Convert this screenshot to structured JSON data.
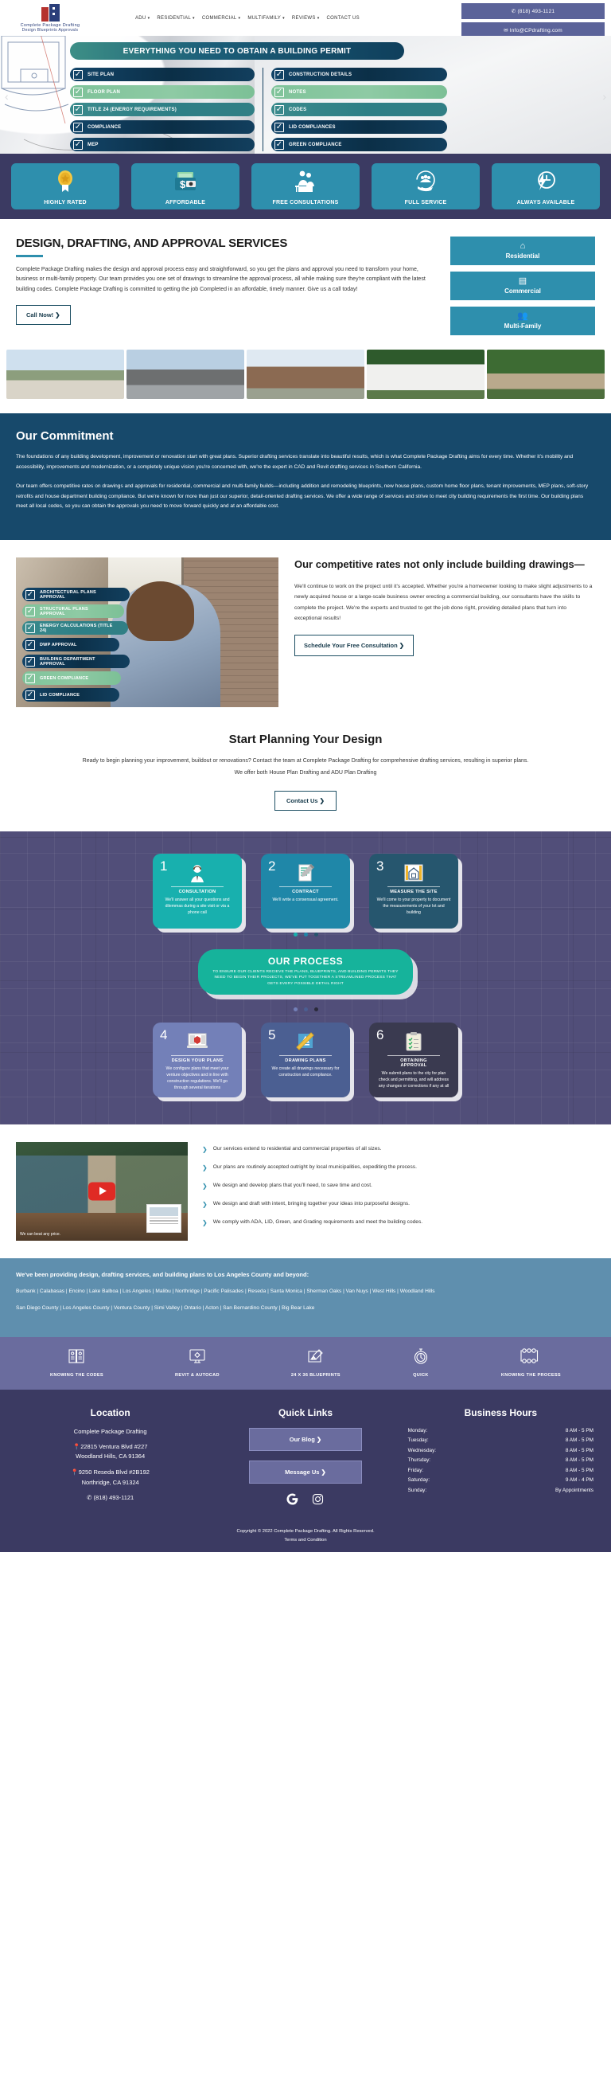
{
  "header": {
    "logo": {
      "line1": "Complete Package Drafting",
      "line2": "Design Blueprints Approvals"
    },
    "nav": [
      {
        "label": "ADU",
        "caret": "▾"
      },
      {
        "label": "RESIDENTIAL",
        "caret": "▾"
      },
      {
        "label": "COMMERCIAL",
        "caret": "▾"
      },
      {
        "label": "MULTIFAMILY",
        "caret": "▾"
      },
      {
        "label": "REVIEWS",
        "caret": "▾"
      },
      {
        "label": "CONTACT US",
        "caret": ""
      }
    ],
    "phone_button": "(818) 493-1121",
    "email_button": "Info@CPdrafting.com",
    "phone_icon": "phone-icon",
    "email_icon": "envelope-icon"
  },
  "hero": {
    "title": "EVERYTHING YOU NEED TO OBTAIN A BUILDING PERMIT",
    "prev_arrow": "‹",
    "next_arrow": "›",
    "left_items": [
      {
        "label": "SITE PLAN",
        "style": "dark"
      },
      {
        "label": "FLOOR PLAN",
        "style": "green"
      },
      {
        "label": "TITLE 24 (ENERGY REQUIREMENTS)",
        "style": "teal"
      },
      {
        "label": "COMPLIANCE",
        "style": "dark"
      },
      {
        "label": "MEP",
        "style": "dark"
      }
    ],
    "right_items": [
      {
        "label": "CONSTRUCTION DETAILS",
        "style": "dark"
      },
      {
        "label": "NOTES",
        "style": "green"
      },
      {
        "label": "CODES",
        "style": "teal"
      },
      {
        "label": "LID COMPLIANCES",
        "style": "dark"
      },
      {
        "label": "GREEN COMPLIANCE",
        "style": "dark"
      }
    ]
  },
  "features": [
    {
      "label": "HIGHLY RATED",
      "icon": "medal-icon",
      "glyph": "🏅"
    },
    {
      "label": "AFFORDABLE",
      "icon": "wallet-money-icon",
      "glyph": "💵"
    },
    {
      "label": "FREE CONSULTATIONS",
      "icon": "consultation-desk-icon",
      "glyph": "🧑‍💼"
    },
    {
      "label": "FULL SERVICE",
      "icon": "hand-people-icon",
      "glyph": "🤝"
    },
    {
      "label": "ALWAYS AVAILABLE",
      "icon": "clock-bolt-icon",
      "glyph": "⏱"
    }
  ],
  "services": {
    "heading": "DESIGN, DRAFTING, AND APPROVAL SERVICES",
    "paragraph": "Complete Package Drafting makes the design and approval process easy and straightforward, so you get the plans and approval you need to transform your home, business or multi-family property. Our team provides you one set of drawings to streamline the approval process, all while making sure they're compliant with the latest building codes. Complete Package Drafting is committed to getting the job Completed in an affordable, timely manner. Give us a call today!",
    "cta": "Call Now! ❯",
    "cards": [
      {
        "label": "Residential",
        "icon": "house-icon",
        "glyph": "⌂"
      },
      {
        "label": "Commercial",
        "icon": "office-building-icon",
        "glyph": "🏢"
      },
      {
        "label": "Multi-Family",
        "icon": "people-group-icon",
        "glyph": "👥"
      }
    ]
  },
  "gallery": [
    {
      "name": "project-photo-1"
    },
    {
      "name": "project-photo-2"
    },
    {
      "name": "project-photo-3"
    },
    {
      "name": "project-photo-4"
    },
    {
      "name": "project-photo-5"
    }
  ],
  "commitment": {
    "heading": "Our Commitment",
    "p1": "The foundations of any building development, improvement or renovation start with great plans. Superior drafting services translate into beautiful results, which is what Complete Package Drafting aims for every time. Whether it's mobility and accessibility, improvements and modernization, or a completely unique vision you're concerned with, we're the expert in CAD and Revit drafting services in Southern California.",
    "p2": "Our team offers competitive rates on drawings and approvals for residential, commercial and multi-family builds—including addition and remodeling blueprints, new house plans, custom home floor plans, tenant improvements, MEP plans, soft-story retrofits and house department building compliance. But we're known for more than just our superior, detail-oriented drafting services. We offer a wide range of services and strive to meet city building requirements the first time. Our building plans meet all local codes, so you can obtain the approvals you need to move forward quickly and at an affordable cost."
  },
  "rates": {
    "heading": "Our competitive rates not only include building drawings—",
    "paragraph": "We'll continue to work on the project until it's accepted. Whether you're a homeowner looking to make slight adjustments to a newly acquired house or a large-scale business owner erecting a commercial building, our consultants have the skills to complete the project. We're the experts and trusted to get the job done right, providing detailed plans that turn into exceptional results!",
    "cta": "Schedule Your Free Consultation ❯",
    "items": [
      {
        "label": "ARCHITECTURAL PLANS APPROVAL",
        "style": "dark",
        "width": 135
      },
      {
        "label": "STRUCTURAL PLANS APPROVAL",
        "style": "green",
        "width": 128
      },
      {
        "label": "ENERGY CALCULATIONS (TITLE 24)",
        "style": "teal",
        "width": 133
      },
      {
        "label": "DWP APPROVAL",
        "style": "dark",
        "width": 122
      },
      {
        "label": "BUILDING DEPARTMENT APPROVAL",
        "style": "dark",
        "width": 135
      },
      {
        "label": "GREEN COMPLIANCE",
        "style": "green",
        "width": 124
      },
      {
        "label": "LID COMPLIANCE",
        "style": "dark",
        "width": 122
      }
    ]
  },
  "planning": {
    "heading": "Start Planning Your Design",
    "p1": "Ready to begin planning your improvement, buildout or renovations? Contact the team at Complete Package Drafting for comprehensive drafting services, resulting in superior plans.",
    "p2": "We offer both House Plan Drafting and ADU Plan Drafting",
    "cta": "Contact Us ❯"
  },
  "process": {
    "pill_title": "OUR PROCESS",
    "pill_text": "TO ENSURE OUR CLIENTS RECIEVE THE PLANS, BLUEPRINTS, AND BUILDING PERMITS THEY NEED TO BEGIN THEIR PROJECTS, WE'VE PUT TOGETHER A STREAMLINED PROCESS THAT GETS EVERY POSSIBLE DETAIL RIGHT",
    "top_steps": [
      {
        "num": "1",
        "title": "CONSULTATION",
        "desc": "We'll answer all your questions and dilemmas during a site visit or via a phone call",
        "icon": "headset-agent-icon",
        "glyph": "🧑‍💼"
      },
      {
        "num": "2",
        "title": "CONTRACT",
        "desc": "We'll write a consensual agreement.",
        "icon": "document-pen-icon",
        "glyph": "📝"
      },
      {
        "num": "3",
        "title": "MEASURE THE SITE",
        "desc": "We'll come to your property to document the measurements of your lot and building",
        "icon": "measure-ruler-icon",
        "glyph": "📐"
      }
    ],
    "bottom_steps": [
      {
        "num": "4",
        "title": "DESIGN YOUR PLANS",
        "desc": "We configure plans that meet your venture objectives and in line with construction regulations. We'll go through several iterations",
        "icon": "laptop-3d-icon",
        "glyph": "💻"
      },
      {
        "num": "5",
        "title": "DRAWING PLANS",
        "desc": "We create all drawings necessary for construction and compliance.",
        "icon": "drafting-tools-icon",
        "glyph": "📏"
      },
      {
        "num": "6",
        "title": "OBTAINING APPROVAL",
        "desc": "We submit plans to the city for plan check and permitting, and will address any changes or corrections if any at all",
        "icon": "clipboard-check-icon",
        "glyph": "📋"
      }
    ]
  },
  "video_section": {
    "play_icon": "play-button-icon",
    "caption": "We can beat any price.",
    "bullets": [
      "Our services extend to residential and commercial properties of all sizes.",
      "Our plans are routinely accepted outright by local municipalities, expediting the process.",
      "We design and develop plans that you'll need, to save time and cost.",
      "We design and draft with intent, bringing together your ideas into purposeful designs.",
      "We comply with ADA, LID, Green, and Grading requirements and meet the building codes."
    ]
  },
  "areas": {
    "heading": "We've been providing design, drafting services, and building plans to Los Angeles County and beyond:",
    "line1": "Burbank | Calabasas | Encino | Lake Balboa | Los Angeles | Malibu | Northridge | Pacific Palisades | Reseda | Santa Monica | Sherman Oaks | Van Nuys | West Hills | Woodland Hills",
    "line2": "San Diego County | Los Angeles County | Ventura County | Simi Valley | Ontario | Acton | San Bernardino County | Big Bear Lake"
  },
  "iconstrip": [
    {
      "label": "KNOWING THE CODES",
      "icon": "open-book-icon",
      "glyph": "📖"
    },
    {
      "label": "REVIT & AUTOCAD",
      "icon": "monitor-cad-icon",
      "glyph": "🖥"
    },
    {
      "label": "24 X 36 BLUEPRINTS",
      "icon": "blueprint-pencil-icon",
      "glyph": "📐"
    },
    {
      "label": "QUICK",
      "icon": "stopwatch-icon",
      "glyph": "⏱"
    },
    {
      "label": "KNOWING THE PROCESS",
      "icon": "flowchart-icon",
      "glyph": "🔗"
    }
  ],
  "footer": {
    "location": {
      "heading": "Location",
      "company": "Complete Package Drafting",
      "pin_icon": "map-pin-icon",
      "address1_line1": "22815 Ventura Blvd #227",
      "address1_line2": "Woodland Hills, CA 91364",
      "address2_line1": "9250 Reseda Blvd #2B192",
      "address2_line2": "Northridge, CA 91324",
      "phone_icon": "phone-icon",
      "phone": "(818) 493-1121"
    },
    "quick_links": {
      "heading": "Quick Links",
      "blog_button": "Our Blog ❯",
      "message_button": "Message Us ❯",
      "google_icon": "google-icon",
      "google_glyph": "G",
      "instagram_icon": "instagram-icon"
    },
    "hours": {
      "heading": "Business Hours",
      "rows": [
        {
          "day": "Monday:",
          "time": "8 AM - 5 PM"
        },
        {
          "day": "Tuesday:",
          "time": "8 AM - 5 PM"
        },
        {
          "day": "Wednesday:",
          "time": "8 AM - 5 PM"
        },
        {
          "day": "Thursday:",
          "time": "8 AM - 5 PM"
        },
        {
          "day": "Friday:",
          "time": "8 AM - 5 PM"
        },
        {
          "day": "Saturday:",
          "time": "9 AM - 4 PM"
        },
        {
          "day": "Sunday:",
          "time": "By Appointments"
        }
      ]
    },
    "copyright": "Copyright © 2022 Complete Package Drafting. All Rights Reserved.",
    "terms": "Terms and Condition"
  },
  "colors": {
    "brand_teal": "#2e8fad",
    "brand_navy": "#3b3a62",
    "deep_blue": "#17496b",
    "green": "#7fc39a",
    "purple": "#6a6c9e"
  }
}
